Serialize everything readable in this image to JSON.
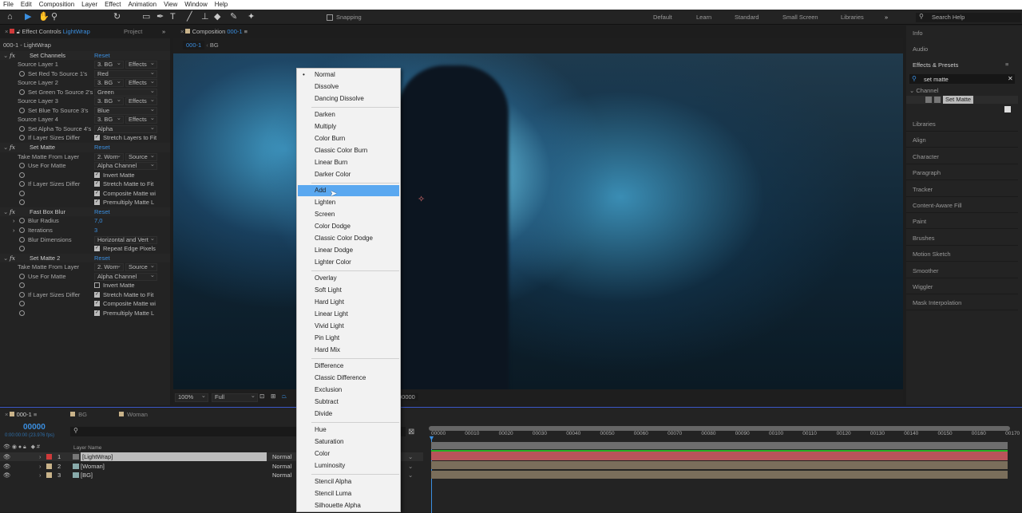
{
  "menubar": [
    "File",
    "Edit",
    "Composition",
    "Layer",
    "Effect",
    "Animation",
    "View",
    "Window",
    "Help"
  ],
  "toolbar": {
    "snapping": "Snapping",
    "workspaces": [
      "Default",
      "Learn",
      "Standard",
      "Small Screen",
      "Libraries"
    ],
    "search_help": "Search Help"
  },
  "left_panel": {
    "tab_label": "Effect Controls",
    "tab_layer": "LightWrap",
    "project_tab": "Project",
    "subtitle": "000-1 - LightWrap"
  },
  "effects": {
    "reset": "Reset",
    "set_channels": {
      "name": "Set Channels",
      "rows": [
        {
          "label": "Source Layer 1",
          "a": "3. BG",
          "b": "Effects"
        },
        {
          "label": "Set Red To Source 1's",
          "v": "Red"
        },
        {
          "label": "Source Layer 2",
          "a": "3. BG",
          "b": "Effects"
        },
        {
          "label": "Set Green To Source 2's",
          "v": "Green"
        },
        {
          "label": "Source Layer 3",
          "a": "3. BG",
          "b": "Effects"
        },
        {
          "label": "Set Blue To Source 3's",
          "v": "Blue"
        },
        {
          "label": "Source Layer 4",
          "a": "3. BG",
          "b": "Effects"
        },
        {
          "label": "Set Alpha To Source 4's",
          "v": "Alpha"
        },
        {
          "label": "If Layer Sizes Differ",
          "check": "Stretch Layers to Fit"
        }
      ]
    },
    "set_matte": {
      "name": "Set Matte",
      "take": "Take Matte From Layer",
      "take_a": "2. Wom",
      "take_b": "Source",
      "use": "Use For Matte",
      "use_v": "Alpha Channel",
      "invert": "Invert Matte",
      "sizes": "If Layer Sizes Differ",
      "stretch": "Stretch Matte to Fit",
      "composite": "Composite Matte wi",
      "premult": "Premultiply Matte L"
    },
    "fast_box_blur": {
      "name": "Fast Box Blur",
      "radius_label": "Blur Radius",
      "radius": "7,0",
      "iter_label": "Iterations",
      "iter": "3",
      "dim_label": "Blur Dimensions",
      "dim": "Horizontal and Vert",
      "repeat": "Repeat Edge Pixels"
    },
    "set_matte_2": {
      "name": "Set Matte 2",
      "take": "Take Matte From Layer",
      "take_a": "2. Wom",
      "take_b": "Source",
      "use": "Use For Matte",
      "use_v": "Alpha Channel",
      "invert": "Invert Matte",
      "sizes": "If Layer Sizes Differ",
      "stretch": "Stretch Matte to Fit",
      "composite": "Composite Matte wi",
      "premult": "Premultiply Matte L"
    }
  },
  "composition": {
    "tab_label": "Composition",
    "tab_name": "000-1",
    "crumb_1": "000-1",
    "crumb_2": "BG",
    "zoom": "100%",
    "resolution": "Full",
    "timecode": "00000"
  },
  "right_panel": {
    "items_top": [
      "Info",
      "Audio"
    ],
    "effects_presets": "Effects & Presets",
    "search_value": "set matte",
    "category": "Channel",
    "result": "Set Matte",
    "items": [
      "Libraries",
      "Align",
      "Character",
      "Paragraph",
      "Tracker",
      "Content-Aware Fill",
      "Paint",
      "Brushes",
      "Motion Sketch",
      "Smoother",
      "Wiggler",
      "Mask Interpolation"
    ]
  },
  "blend_menu": {
    "selected": "Normal",
    "highlighted": "Add",
    "groups": [
      [
        "Normal",
        "Dissolve",
        "Dancing Dissolve"
      ],
      [
        "Darken",
        "Multiply",
        "Color Burn",
        "Classic Color Burn",
        "Linear Burn",
        "Darker Color"
      ],
      [
        "Add",
        "Lighten",
        "Screen",
        "Color Dodge",
        "Classic Color Dodge",
        "Linear Dodge",
        "Lighter Color"
      ],
      [
        "Overlay",
        "Soft Light",
        "Hard Light",
        "Linear Light",
        "Vivid Light",
        "Pin Light",
        "Hard Mix"
      ],
      [
        "Difference",
        "Classic Difference",
        "Exclusion",
        "Subtract",
        "Divide"
      ],
      [
        "Hue",
        "Saturation",
        "Color",
        "Luminosity"
      ],
      [
        "Stencil Alpha",
        "Stencil Luma",
        "Silhouette Alpha"
      ]
    ]
  },
  "timeline": {
    "tabs": [
      "000-1",
      "BG",
      "Woman"
    ],
    "timecode": "00000",
    "timecode_sub": "0:00:00:00 (23.976 fps)",
    "col_layer_name": "Layer Name",
    "layers": [
      {
        "num": "1",
        "name": "[LightWrap]",
        "mode": "Normal",
        "color": "#d03a3a"
      },
      {
        "num": "2",
        "name": "[Woman]",
        "mode": "Normal",
        "color": "#c9b38a"
      },
      {
        "num": "3",
        "name": "[BG]",
        "mode": "Normal",
        "color": "#c9b38a"
      }
    ],
    "ruler": [
      "00000",
      "00010",
      "00020",
      "00030",
      "00040",
      "00050",
      "00060",
      "00070",
      "00080",
      "00090",
      "00100",
      "00110",
      "00120",
      "00130",
      "00140",
      "00150",
      "00160",
      "00170"
    ]
  }
}
